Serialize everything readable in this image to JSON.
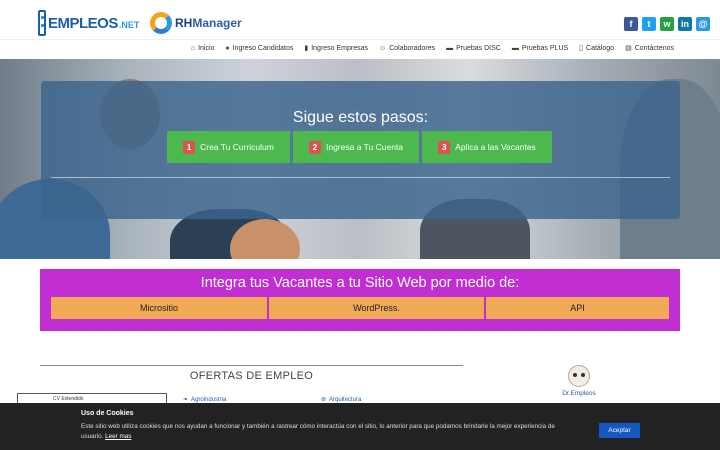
{
  "brand": {
    "empleos_text": "EMPLEOS",
    "empleos_suffix": ".NET",
    "rh_prefix": "RH",
    "rh_text": "Manager"
  },
  "social": [
    {
      "icon": "facebook-icon",
      "glyph": "f",
      "color": "#3b5998"
    },
    {
      "icon": "twitter-icon",
      "glyph": "t",
      "color": "#1da1f2"
    },
    {
      "icon": "whatsapp-icon",
      "glyph": "w",
      "color": "#25a244"
    },
    {
      "icon": "linkedin-icon",
      "glyph": "in",
      "color": "#0e76a8"
    },
    {
      "icon": "email-icon",
      "glyph": "@",
      "color": "#2a9be0"
    }
  ],
  "nav": [
    {
      "label": "Inicio",
      "icon": "home-icon",
      "glyph": "⌂"
    },
    {
      "label": "Ingreso Candidatos",
      "icon": "user-icon",
      "glyph": "●"
    },
    {
      "label": "Ingreso Empresas",
      "icon": "building-icon",
      "glyph": "▮"
    },
    {
      "label": "Colaboradores",
      "icon": "smile-icon",
      "glyph": "☺"
    },
    {
      "label": "Pruebas DISC",
      "icon": "briefcase-icon",
      "glyph": "▬"
    },
    {
      "label": "Pruebas PLUS",
      "icon": "briefcase-icon",
      "glyph": "▬"
    },
    {
      "label": "Catálogo",
      "icon": "file-icon",
      "glyph": "▯"
    },
    {
      "label": "Contáctenos",
      "icon": "contact-card-icon",
      "glyph": "▤"
    }
  ],
  "steps": {
    "title": "Sigue estos pasos:",
    "items": [
      {
        "num": "1",
        "label": "Crea Tu Curriculum"
      },
      {
        "num": "2",
        "label": "Ingresa a Tu Cuenta"
      },
      {
        "num": "3",
        "label": "Aplica a las Vacantes"
      }
    ]
  },
  "integra": {
    "title": "Integra tus Vacantes a tu Sitio Web por medio de:",
    "options": [
      "Micrositio",
      "WordPress.",
      "API"
    ]
  },
  "ofertas": {
    "title": "OFERTAS DE EMPLEO",
    "cv_label": "CV Extendido",
    "categories": [
      "Agroindustria",
      "Arquitectura"
    ]
  },
  "dr": {
    "name": "Dr.Empleos"
  },
  "cookie": {
    "title": "Uso de Cookies",
    "text": "Este sitio web utiliza cookies que nos ayudan a funcionar y también a rastrear cómo interactúa con el sitio, lo anterior para que podamos brindarle la mejor experiencia de usuario.",
    "more": "Leer mas",
    "accept": "Aceptar"
  },
  "colors": {
    "accent_blue": "#1e5ea8",
    "step_green": "#4cb84e",
    "step_num_red": "#d9534f",
    "integra_purple": "#c12fd3",
    "integra_button": "#f0a954",
    "cookie_bg": "#222222",
    "cookie_button": "#1656c0"
  }
}
